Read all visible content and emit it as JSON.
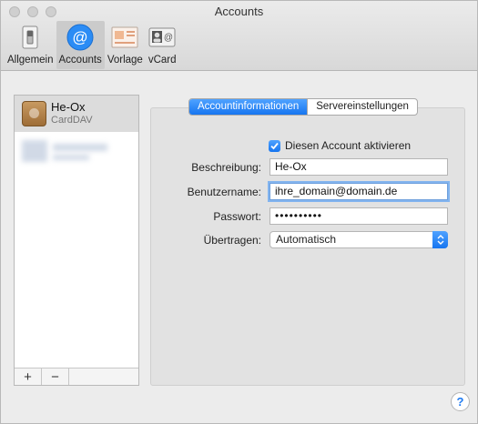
{
  "window": {
    "title": "Accounts"
  },
  "toolbar": {
    "items": [
      {
        "label": "Allgemein",
        "icon": "general-switch-icon"
      },
      {
        "label": "Accounts",
        "icon": "at-sign-icon",
        "active": true
      },
      {
        "label": "Vorlage",
        "icon": "template-icon"
      },
      {
        "label": "vCard",
        "icon": "vcard-icon"
      }
    ]
  },
  "accounts": {
    "items": [
      {
        "name": "He-Ox",
        "type": "CardDAV",
        "selected": true
      }
    ],
    "add_label": "+",
    "remove_label": "−"
  },
  "tabs": [
    {
      "label": "Accountinformationen",
      "active": true
    },
    {
      "label": "Servereinstellungen",
      "active": false
    }
  ],
  "form": {
    "enable_label": "Diesen Account aktivieren",
    "enable_checked": true,
    "description_label": "Beschreibung:",
    "description_value": "He-Ox",
    "username_label": "Benutzername:",
    "username_value": "ihre_domain@domain.de",
    "password_label": "Passwort:",
    "password_value": "••••••••••",
    "transfer_label": "Übertragen:",
    "transfer_value": "Automatisch"
  },
  "help": {
    "label": "?"
  },
  "colors": {
    "accent": "#1675f0",
    "panel": "#e2e2e2",
    "window": "#ececec"
  }
}
